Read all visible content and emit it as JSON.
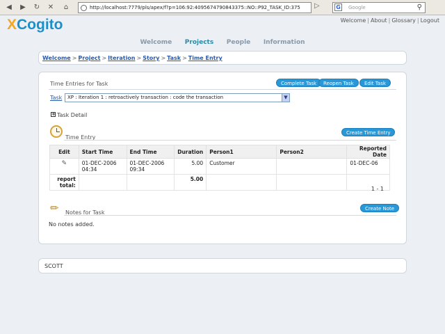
{
  "browser": {
    "url": "http://localhost:7779/pls/apex/f?p=106:92:4095674790843375::NO::P92_TASK_ID:375",
    "search_placeholder": "Google"
  },
  "header": {
    "logo_x": "X",
    "logo_rest": "Cogito",
    "links": [
      "Welcome",
      "About",
      "Glossary",
      "Logout"
    ]
  },
  "nav": {
    "tabs": [
      "Welcome",
      "Projects",
      "People",
      "Information"
    ],
    "active": "Projects"
  },
  "breadcrumb": [
    "Welcome",
    "Project",
    "Iteration",
    "Story",
    "Task",
    "Time Entry"
  ],
  "time_entries": {
    "title": "Time Entries for Task",
    "buttons": {
      "complete": "Complete Task",
      "reopen": "Reopen Task",
      "edit": "Edit Task"
    },
    "task_label": "Task",
    "task_value": "XP : Iteration 1 : retroactively transaction : code the transaction",
    "task_detail": "Task Detail"
  },
  "time_entry": {
    "title": "Time Entry",
    "create_button": "Create Time Entry",
    "columns": [
      "Edit",
      "Start Time",
      "End Time",
      "Duration",
      "Person1",
      "Person2",
      "Reported Date"
    ],
    "rows": [
      {
        "start": "01-DEC-2006 04:34",
        "end": "01-DEC-2006 09:34",
        "duration": "5.00",
        "person1": "Customer",
        "person2": "",
        "reported": "01-DEC-06"
      }
    ],
    "total_label": "report total:",
    "total_value": "5.00",
    "pager": "1 - 1"
  },
  "notes": {
    "title": "Notes for Task",
    "create_button": "Create Note",
    "empty": "No notes added."
  },
  "user": "SCOTT"
}
